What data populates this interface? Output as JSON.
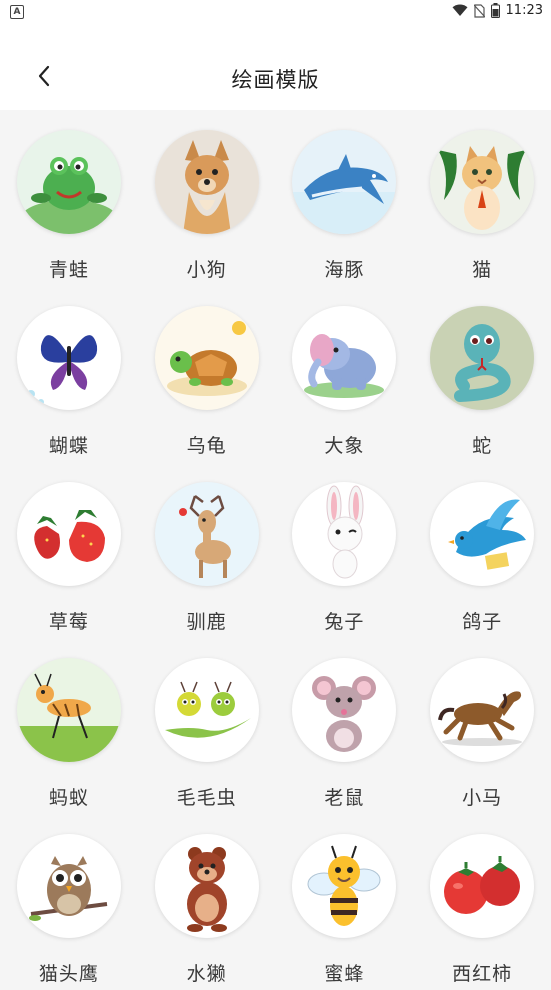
{
  "status_bar": {
    "left_icon": "A",
    "time": "11:23",
    "icons": [
      "wifi-icon",
      "no-sim-icon",
      "battery-icon"
    ]
  },
  "header": {
    "back_icon": "chevron-left-icon",
    "title": "绘画模版"
  },
  "templates": [
    {
      "label": "青蛙",
      "icon": "frog-icon",
      "bg": "#e8f4ea"
    },
    {
      "label": "小狗",
      "icon": "dog-icon",
      "bg": "#f1ebe4"
    },
    {
      "label": "海豚",
      "icon": "dolphin-icon",
      "bg": "#e6f2f9"
    },
    {
      "label": "猫",
      "icon": "cat-icon",
      "bg": "#eef2ea"
    },
    {
      "label": "蝴蝶",
      "icon": "butterfly-icon",
      "bg": "#ffffff"
    },
    {
      "label": "乌龟",
      "icon": "turtle-icon",
      "bg": "#fdf8ec"
    },
    {
      "label": "大象",
      "icon": "elephant-icon",
      "bg": "#ffffff"
    },
    {
      "label": "蛇",
      "icon": "snake-icon",
      "bg": "#c9d2b4"
    },
    {
      "label": "草莓",
      "icon": "strawberry-icon",
      "bg": "#ffffff"
    },
    {
      "label": "驯鹿",
      "icon": "reindeer-icon",
      "bg": "#e9f5fb"
    },
    {
      "label": "兔子",
      "icon": "rabbit-icon",
      "bg": "#ffffff"
    },
    {
      "label": "鸽子",
      "icon": "pigeon-icon",
      "bg": "#ffffff"
    },
    {
      "label": "蚂蚁",
      "icon": "ant-icon",
      "bg": "#eaf5e4"
    },
    {
      "label": "毛毛虫",
      "icon": "caterpillar-icon",
      "bg": "#ffffff"
    },
    {
      "label": "老鼠",
      "icon": "mouse-icon",
      "bg": "#ffffff"
    },
    {
      "label": "小马",
      "icon": "horse-icon",
      "bg": "#ffffff"
    },
    {
      "label": "猫头鹰",
      "icon": "owl-icon",
      "bg": "#ffffff"
    },
    {
      "label": "水獭",
      "icon": "otter-icon",
      "bg": "#ffffff"
    },
    {
      "label": "蜜蜂",
      "icon": "bee-icon",
      "bg": "#ffffff"
    },
    {
      "label": "西红柿",
      "icon": "tomato-icon",
      "bg": "#ffffff"
    }
  ]
}
